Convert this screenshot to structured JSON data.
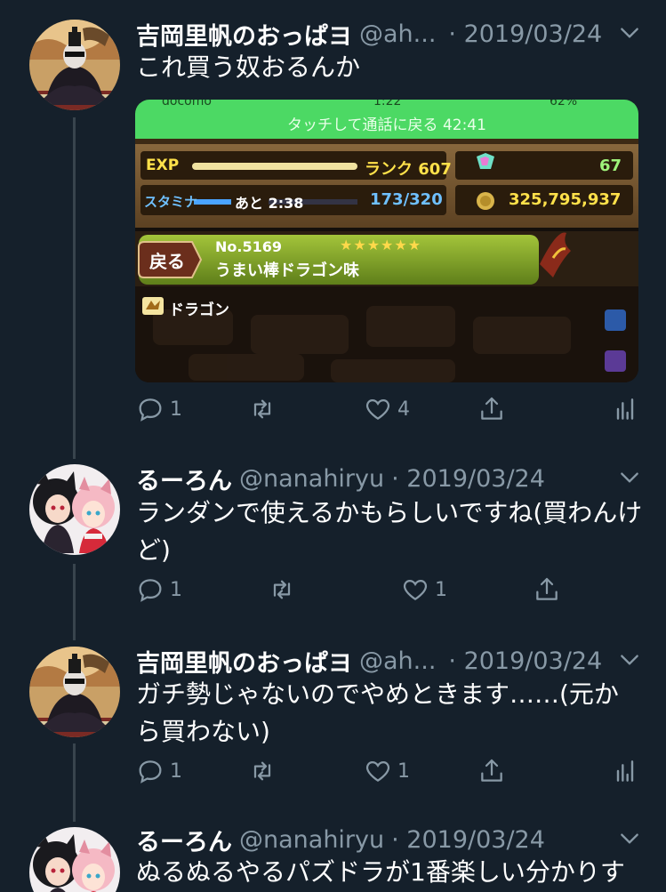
{
  "tweets": [
    {
      "name": "吉岡里帆のおっぱヨ",
      "handle": "@ah...",
      "date": "· 2019/03/24",
      "text": "これ買う奴おるんか",
      "reply_count": "1",
      "retweet_count": "",
      "like_count": "4"
    },
    {
      "name": "るーろん",
      "handle": "@nanahiryu",
      "date": "· 2019/03/24",
      "text": "ランダンで使えるかもらしいですね(買わんけど)",
      "reply_count": "1",
      "retweet_count": "",
      "like_count": "1"
    },
    {
      "name": "吉岡里帆のおっぱヨ",
      "handle": "@ah...",
      "date": "· 2019/03/24",
      "text": "ガチ勢じゃないのでやめときます……(元から買わない)",
      "reply_count": "1",
      "retweet_count": "",
      "like_count": "1"
    },
    {
      "name": "るーろん",
      "handle": "@nanahiryu",
      "date": "· 2019/03/24",
      "text": "ぬるぬるやるパズドラが1番楽しい分かりす"
    }
  ],
  "media": {
    "status_bar_carrier": "docomo",
    "status_bar_time": "1:22",
    "status_bar_battery": "62%",
    "call_banner": "タッチして通話に戻る 42:41",
    "exp_label": "EXP",
    "rank_label": "ランク 607",
    "stamina_label": "スタミナ",
    "stamina_timer": "あと 2:38",
    "stamina_value": "173/320",
    "stones_count": "67",
    "coins_value": "325,795,937",
    "back_button": "戻る",
    "monster_number": "No.5169",
    "monster_stars": "★★★★★★",
    "monster_name": "うまい棒ドラゴン味",
    "monster_type": "ドラゴン",
    "accent_green": "#4cd964"
  }
}
